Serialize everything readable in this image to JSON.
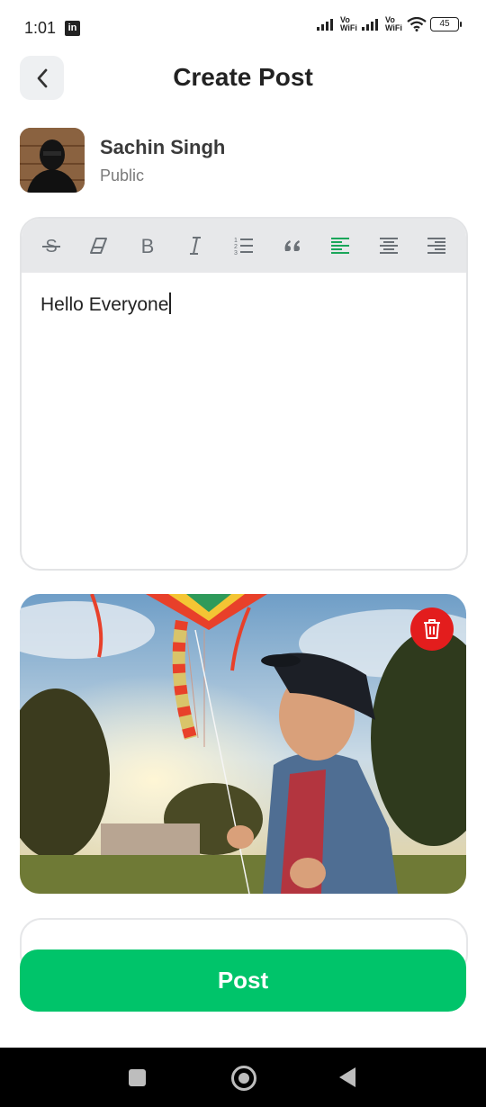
{
  "status_bar": {
    "time": "1:01",
    "linkedin_badge": "in",
    "network_label_1": "Vo WiFi",
    "network_label_2": "Vo WiFi",
    "battery": "45"
  },
  "header": {
    "title": "Create Post",
    "back_icon": "chevron-left-icon"
  },
  "user": {
    "name": "Sachin Singh",
    "privacy": "Public"
  },
  "editor": {
    "toolbar": [
      {
        "icon": "strikethrough-icon"
      },
      {
        "icon": "eraser-icon"
      },
      {
        "icon": "bold-icon"
      },
      {
        "icon": "italic-icon"
      },
      {
        "icon": "ordered-list-icon"
      },
      {
        "icon": "quote-icon"
      },
      {
        "icon": "align-left-icon",
        "active": true
      },
      {
        "icon": "align-center-icon"
      },
      {
        "icon": "align-right-icon"
      }
    ],
    "text": "Hello Everyone"
  },
  "image": {
    "delete_icon": "trash-icon"
  },
  "actions": {
    "post_label": "Post"
  },
  "colors": {
    "accent": "#00c46a",
    "active_tool": "#1aa65a",
    "delete": "#e31d1d"
  }
}
